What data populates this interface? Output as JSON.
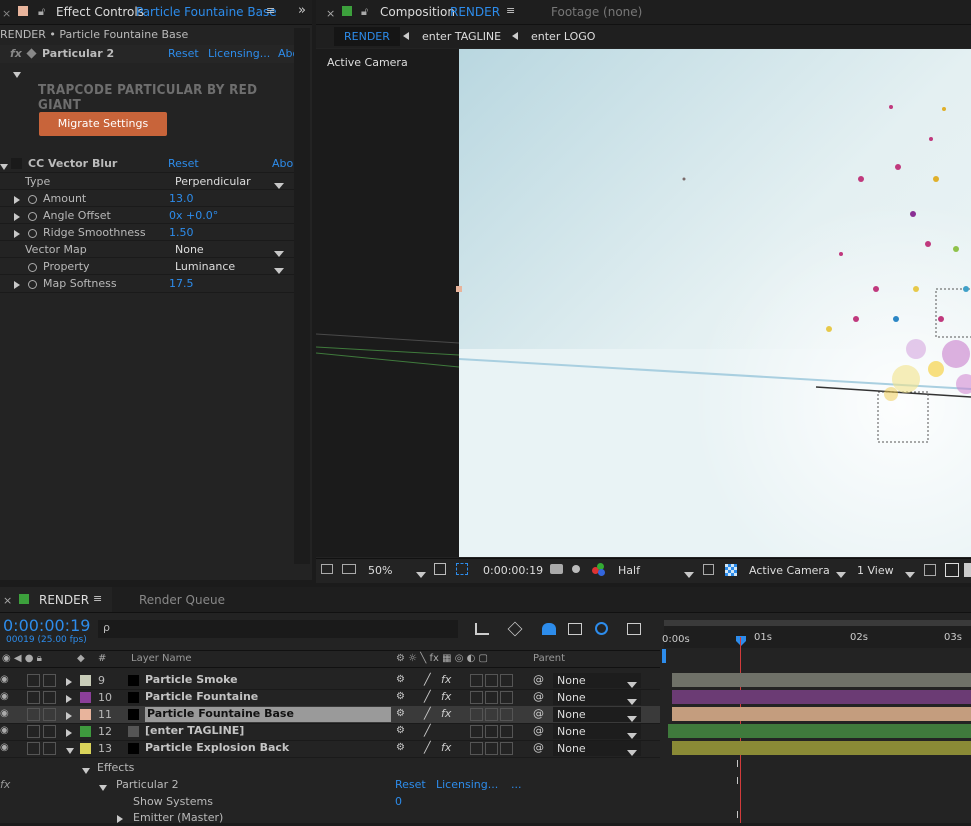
{
  "effect_controls": {
    "tab_title": "Effect Controls",
    "tab_layer": "Particle Fountaine Base",
    "breadcrumb": "RENDER • Particle Fountaine Base",
    "particular": {
      "name": "Particular 2",
      "reset": "Reset",
      "licensing": "Licensing...",
      "about": "Abo",
      "banner": "TRAPCODE PARTICULAR BY RED GIANT",
      "migrate_button": "Migrate Settings"
    },
    "cc_vector_blur": {
      "name": "CC Vector Blur",
      "reset": "Reset",
      "about": "Abo",
      "params": [
        {
          "label": "Type",
          "value": "Perpendicular"
        },
        {
          "label": "Amount",
          "value": "13.0"
        },
        {
          "label": "Angle Offset",
          "value": "0x +0.0°"
        },
        {
          "label": "Ridge Smoothness",
          "value": "1.50"
        },
        {
          "label": "Vector Map",
          "value": "None"
        },
        {
          "label": "Property",
          "value": "Luminance"
        },
        {
          "label": "Map Softness",
          "value": "17.5"
        }
      ]
    }
  },
  "composition": {
    "tab_title": "Composition",
    "tab_name": "RENDER",
    "footage_tab": "Footage (none)",
    "nav": [
      "RENDER",
      "enter TAGLINE",
      "enter LOGO"
    ],
    "view_label": "Active Camera",
    "footer": {
      "zoom": "50%",
      "timecode": "0:00:00:19",
      "resolution": "Half",
      "camera": "Active Camera",
      "views": "1 View"
    }
  },
  "timeline": {
    "tab_render": "RENDER",
    "tab_queue": "Render Queue",
    "timecode": "0:00:00:19",
    "frames": "00019 (25.00 fps)",
    "search_placeholder": "",
    "col_layer_name": "Layer Name",
    "col_parent": "Parent",
    "ruler": [
      "0:00s",
      "01s",
      "02s",
      "03s"
    ],
    "layers": [
      {
        "num": "9",
        "name": "Particle Smoke",
        "color": "#c8ccb8",
        "parent": "None",
        "bar": "#6f7168"
      },
      {
        "num": "10",
        "name": "Particle Fountaine",
        "color": "#8b3f99",
        "parent": "None",
        "bar": "#6b3b74"
      },
      {
        "num": "11",
        "name": "Particle Fountaine Base",
        "color": "#e8b49c",
        "parent": "None",
        "bar": "#c49d7e"
      },
      {
        "num": "12",
        "name": "[enter TAGLINE]",
        "color": "#3e9a3e",
        "parent": "None",
        "bar": "#3f7a3c"
      },
      {
        "num": "13",
        "name": "Particle Explosion Back",
        "color": "#d9d35a",
        "parent": "None",
        "bar": "#8a8a36"
      }
    ],
    "sub": {
      "effects": "Effects",
      "particular": "Particular 2",
      "reset": "Reset",
      "licensing": "Licensing...",
      "dots": "...",
      "show_systems": "Show Systems",
      "show_systems_value": "0",
      "emitter": "Emitter (Master)"
    }
  }
}
